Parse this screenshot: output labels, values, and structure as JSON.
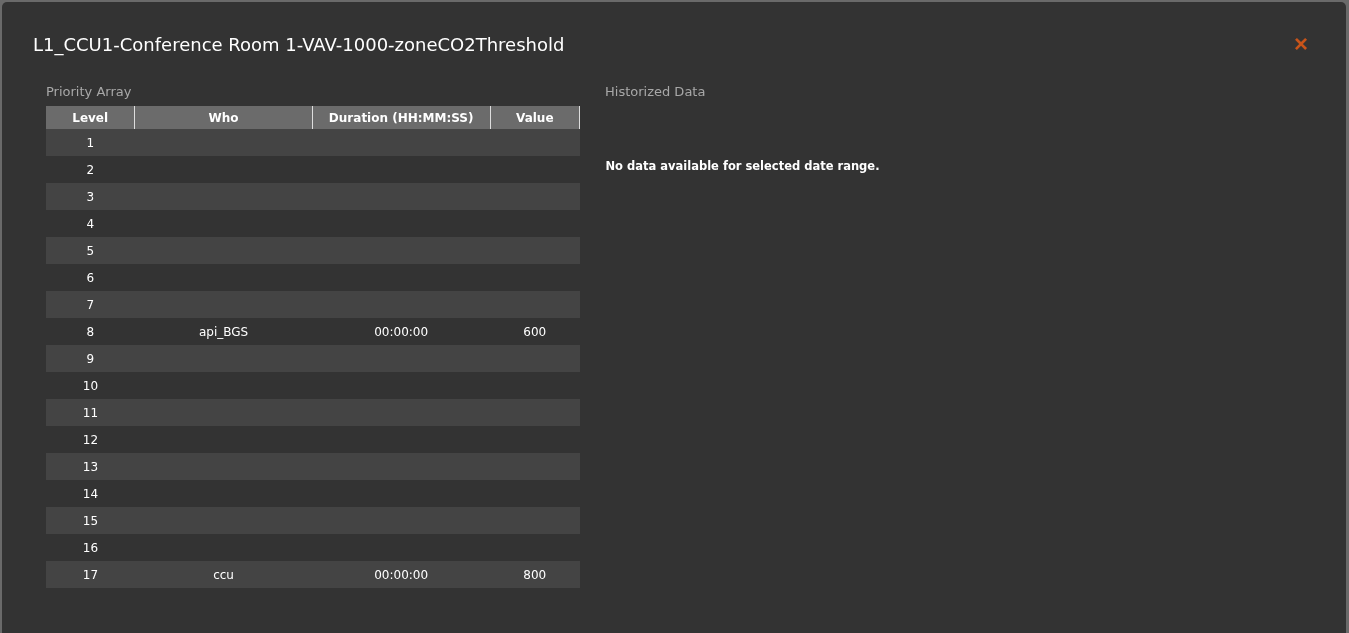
{
  "dialog": {
    "title": "L1_CCU1-Conference Room 1-VAV-1000-zoneCO2Threshold",
    "close_icon": "×"
  },
  "priority_array": {
    "heading": "Priority Array",
    "columns": [
      "Level",
      "Who",
      "Duration (HH:MM:SS)",
      "Value"
    ],
    "rows": [
      {
        "level": "1"
      },
      {
        "level": "2"
      },
      {
        "level": "3"
      },
      {
        "level": "4"
      },
      {
        "level": "5"
      },
      {
        "level": "6"
      },
      {
        "level": "7"
      },
      {
        "level": "8",
        "who": "api_BGS",
        "duration": "00:00:00",
        "value": "600"
      },
      {
        "level": "9"
      },
      {
        "level": "10"
      },
      {
        "level": "11"
      },
      {
        "level": "12"
      },
      {
        "level": "13"
      },
      {
        "level": "14"
      },
      {
        "level": "15"
      },
      {
        "level": "16"
      },
      {
        "level": "17",
        "who": "ccu",
        "duration": "00:00:00",
        "value": "800"
      }
    ]
  },
  "historized_data": {
    "heading": "Historized Data",
    "message": "No data available for selected date range."
  }
}
